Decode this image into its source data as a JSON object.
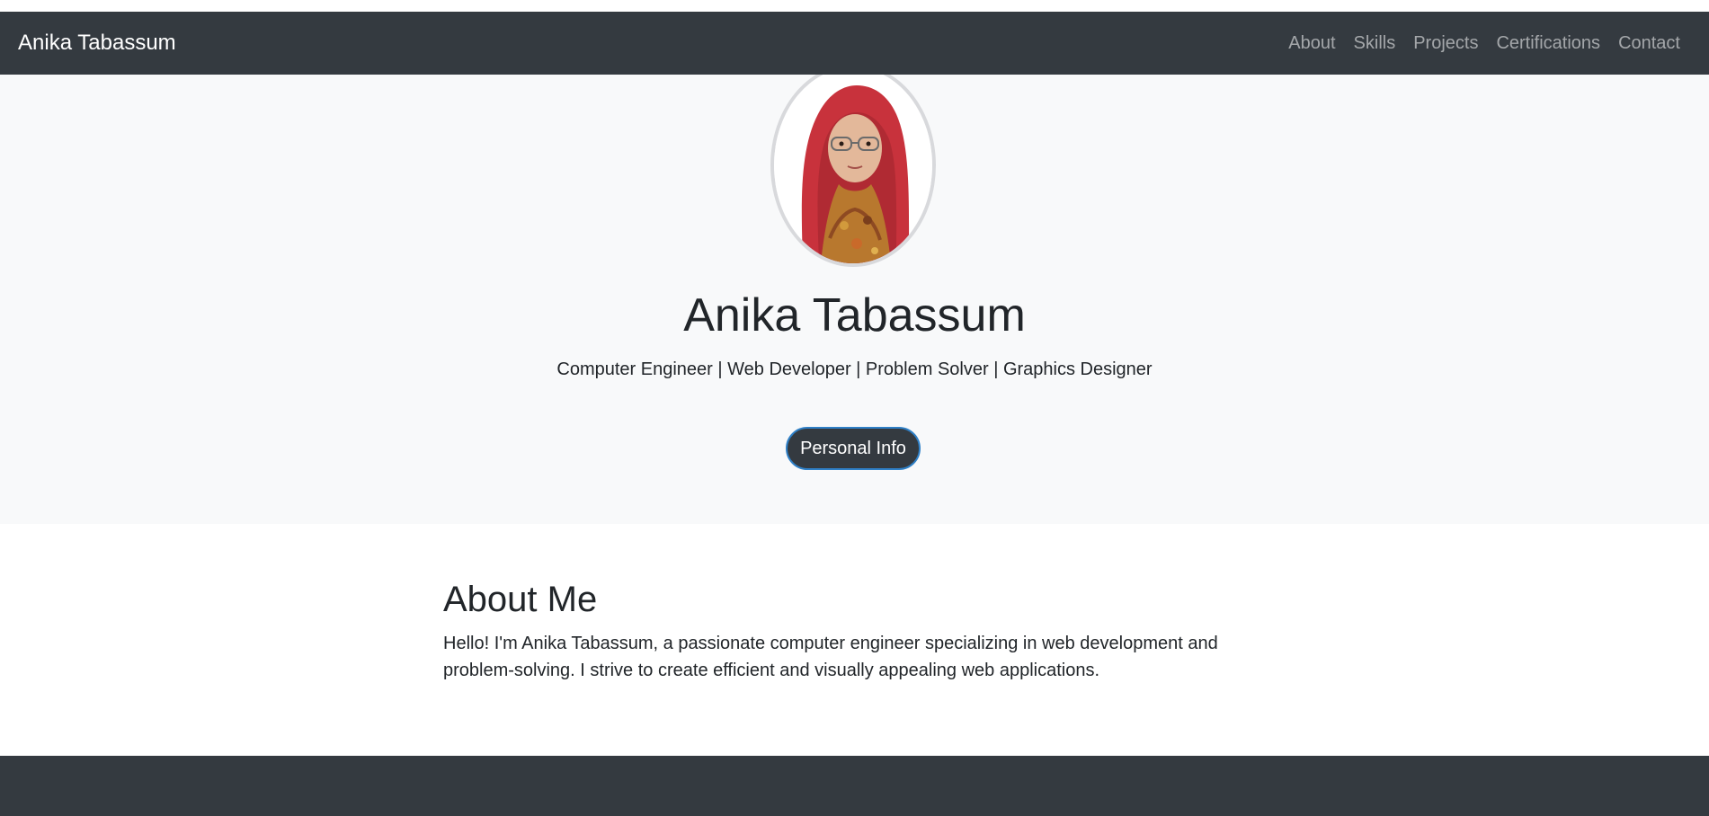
{
  "navbar": {
    "brand": "Anika Tabassum",
    "links": [
      "About",
      "Skills",
      "Projects",
      "Certifications",
      "Contact"
    ]
  },
  "hero": {
    "name": "Anika Tabassum",
    "tagline": "Computer Engineer | Web Developer | Problem Solver | Graphics Designer",
    "button_label": "Personal Info",
    "avatar_icon": "profile-photo"
  },
  "about": {
    "title": "About Me",
    "text_line1": "Hello! I'm Anika Tabassum, a passionate computer engineer specializing in web development and",
    "text_line2": "problem-solving. I strive to create efficient and visually appealing web applications."
  },
  "colors": {
    "navbar_bg": "#343a40",
    "hero_bg": "#f8f9fa",
    "button_border": "#2f80c7",
    "text": "#212529"
  }
}
